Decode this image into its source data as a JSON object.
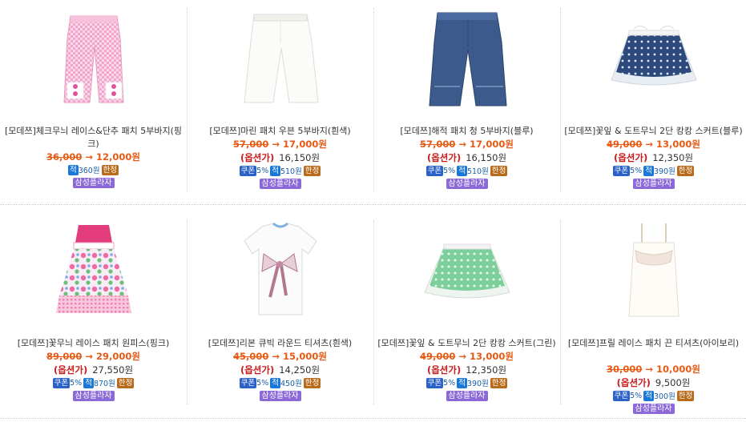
{
  "labels": {
    "option": "(옵션가)",
    "coupon": "쿠폰",
    "point": "적",
    "limited": "한정",
    "card": "삼성플라자",
    "arrow": "→"
  },
  "products": [
    {
      "name": "[모데쯔]체크무늬 레이스&단추 패치 5부바지(핑크)",
      "orig": "36,000",
      "sale": "12,000원",
      "option": null,
      "coupon": null,
      "point": "360원",
      "limited": true,
      "image": "pink-check-pants-icon"
    },
    {
      "name": "[모데쯔]마린 패치 우븐 5부바지(흰색)",
      "orig": "57,000",
      "sale": "17,000원",
      "option": "16,150원",
      "coupon": "5%",
      "point": "510원",
      "limited": true,
      "image": "white-pants-icon"
    },
    {
      "name": "[모데쯔]해적 패치 청 5부바지(블루)",
      "orig": "57,000",
      "sale": "17,000원",
      "option": "16,150원",
      "coupon": "5%",
      "point": "510원",
      "limited": true,
      "image": "denim-pants-icon"
    },
    {
      "name": "[모데쯔]꽃잎 & 도트무늬 2단 캉캉 스커트(블루)",
      "orig": "49,000",
      "sale": "13,000원",
      "option": "12,350원",
      "coupon": "5%",
      "point": "390원",
      "limited": true,
      "image": "blue-skirt-icon"
    },
    {
      "name": "[모데쯔]꽃무늬 레이스 패치 원피스(핑크)",
      "orig": "89,000",
      "sale": "29,000원",
      "option": "27,550원",
      "coupon": "5%",
      "point": "870원",
      "limited": true,
      "image": "pink-dress-icon"
    },
    {
      "name": "[모데쯔]리본 큐빅 라운드 티셔츠(흰색)",
      "orig": "45,000",
      "sale": "15,000원",
      "option": "14,250원",
      "coupon": "5%",
      "point": "450원",
      "limited": true,
      "image": "ribbon-tshirt-icon"
    },
    {
      "name": "[모데쯔]꽃잎 & 도트무늬 2단 캉캉 스커트(그린)",
      "orig": "49,000",
      "sale": "13,000원",
      "option": "12,350원",
      "coupon": "5%",
      "point": "390원",
      "limited": true,
      "image": "green-skirt-icon"
    },
    {
      "name": "[모데쯔]프릴 레이스 패치 끈 티셔츠(아이보리)",
      "orig": "30,000",
      "sale": "10,000원",
      "option": "9,500원",
      "coupon": "5%",
      "point": "300원",
      "limited": true,
      "image": "ivory-camisole-icon"
    }
  ]
}
